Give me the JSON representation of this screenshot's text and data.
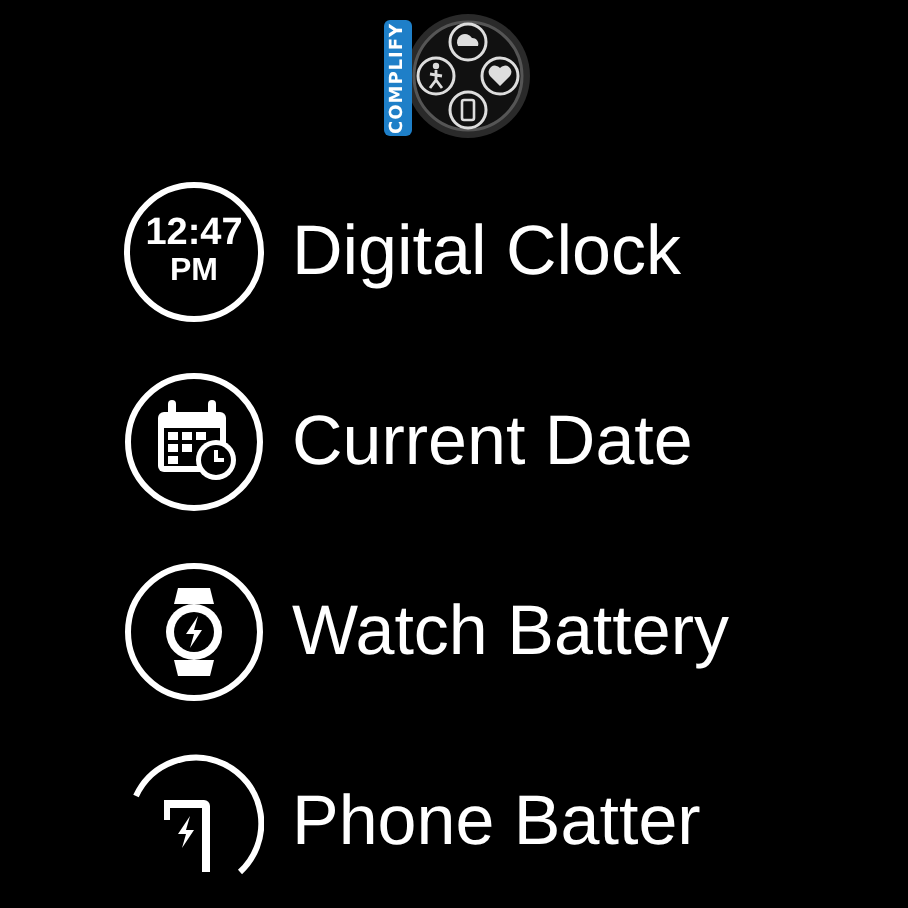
{
  "logo": {
    "text": "COMPLIFY"
  },
  "items": [
    {
      "kind": "clock",
      "time": "12:47",
      "period": "PM",
      "label": "Digital Clock"
    },
    {
      "kind": "date",
      "label": "Current Date"
    },
    {
      "kind": "watch_battery",
      "label": "Watch Battery"
    },
    {
      "kind": "phone_battery",
      "label": "Phone Batter"
    }
  ]
}
